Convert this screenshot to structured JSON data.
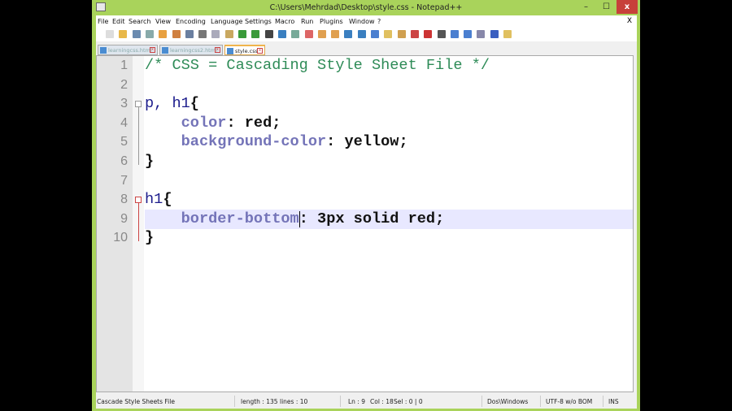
{
  "window": {
    "title": "C:\\Users\\Mehrdad\\Desktop\\style.css - Notepad++",
    "frame_color": "#a9d35b",
    "close_color": "#c7413a",
    "minimize": "–",
    "maximize": "☐",
    "close": "x"
  },
  "menu": {
    "items": [
      "File",
      "Edit",
      "Search",
      "View",
      "Encoding",
      "Language",
      "Settings",
      "Macro",
      "Run",
      "Plugins",
      "Window",
      "?"
    ],
    "close_doc": "X"
  },
  "tabs": [
    {
      "label": "learningcss.html",
      "active": false
    },
    {
      "label": "learningcss2.html",
      "active": false
    },
    {
      "label": "style.css",
      "active": true
    }
  ],
  "editor": {
    "current_line": 9,
    "lines": [
      [
        [
          "/* CSS = Cascading Style Sheet File */",
          "comment"
        ]
      ],
      [],
      [
        [
          "p, h1",
          "sel"
        ],
        [
          "{",
          "punct"
        ]
      ],
      [
        [
          "    ",
          ""
        ],
        [
          "color",
          "prop"
        ],
        [
          ": ",
          "punct"
        ],
        [
          "red",
          "val"
        ],
        [
          ";",
          "punct"
        ]
      ],
      [
        [
          "    ",
          ""
        ],
        [
          "background-color",
          "prop"
        ],
        [
          ": ",
          "punct"
        ],
        [
          "yellow",
          "val"
        ],
        [
          ";",
          "punct"
        ]
      ],
      [
        [
          "}",
          "punct"
        ]
      ],
      [],
      [
        [
          "h1",
          "sel"
        ],
        [
          "{",
          "punct"
        ]
      ],
      [
        [
          "    ",
          ""
        ],
        [
          "border-bottom",
          "prop"
        ],
        [
          ": ",
          "punct"
        ],
        [
          "3px solid red",
          "val"
        ],
        [
          ";",
          "punct"
        ]
      ],
      [
        [
          "}",
          "punct"
        ]
      ]
    ]
  },
  "status": {
    "file_type": "Cascade Style Sheets File",
    "length": "length : 135",
    "lines": "lines : 10",
    "ln": "Ln : 9",
    "col": "Col : 18",
    "sel": "Sel : 0 | 0",
    "eol": "Dos\\Windows",
    "encoding": "UTF-8 w/o BOM",
    "mode": "INS"
  }
}
